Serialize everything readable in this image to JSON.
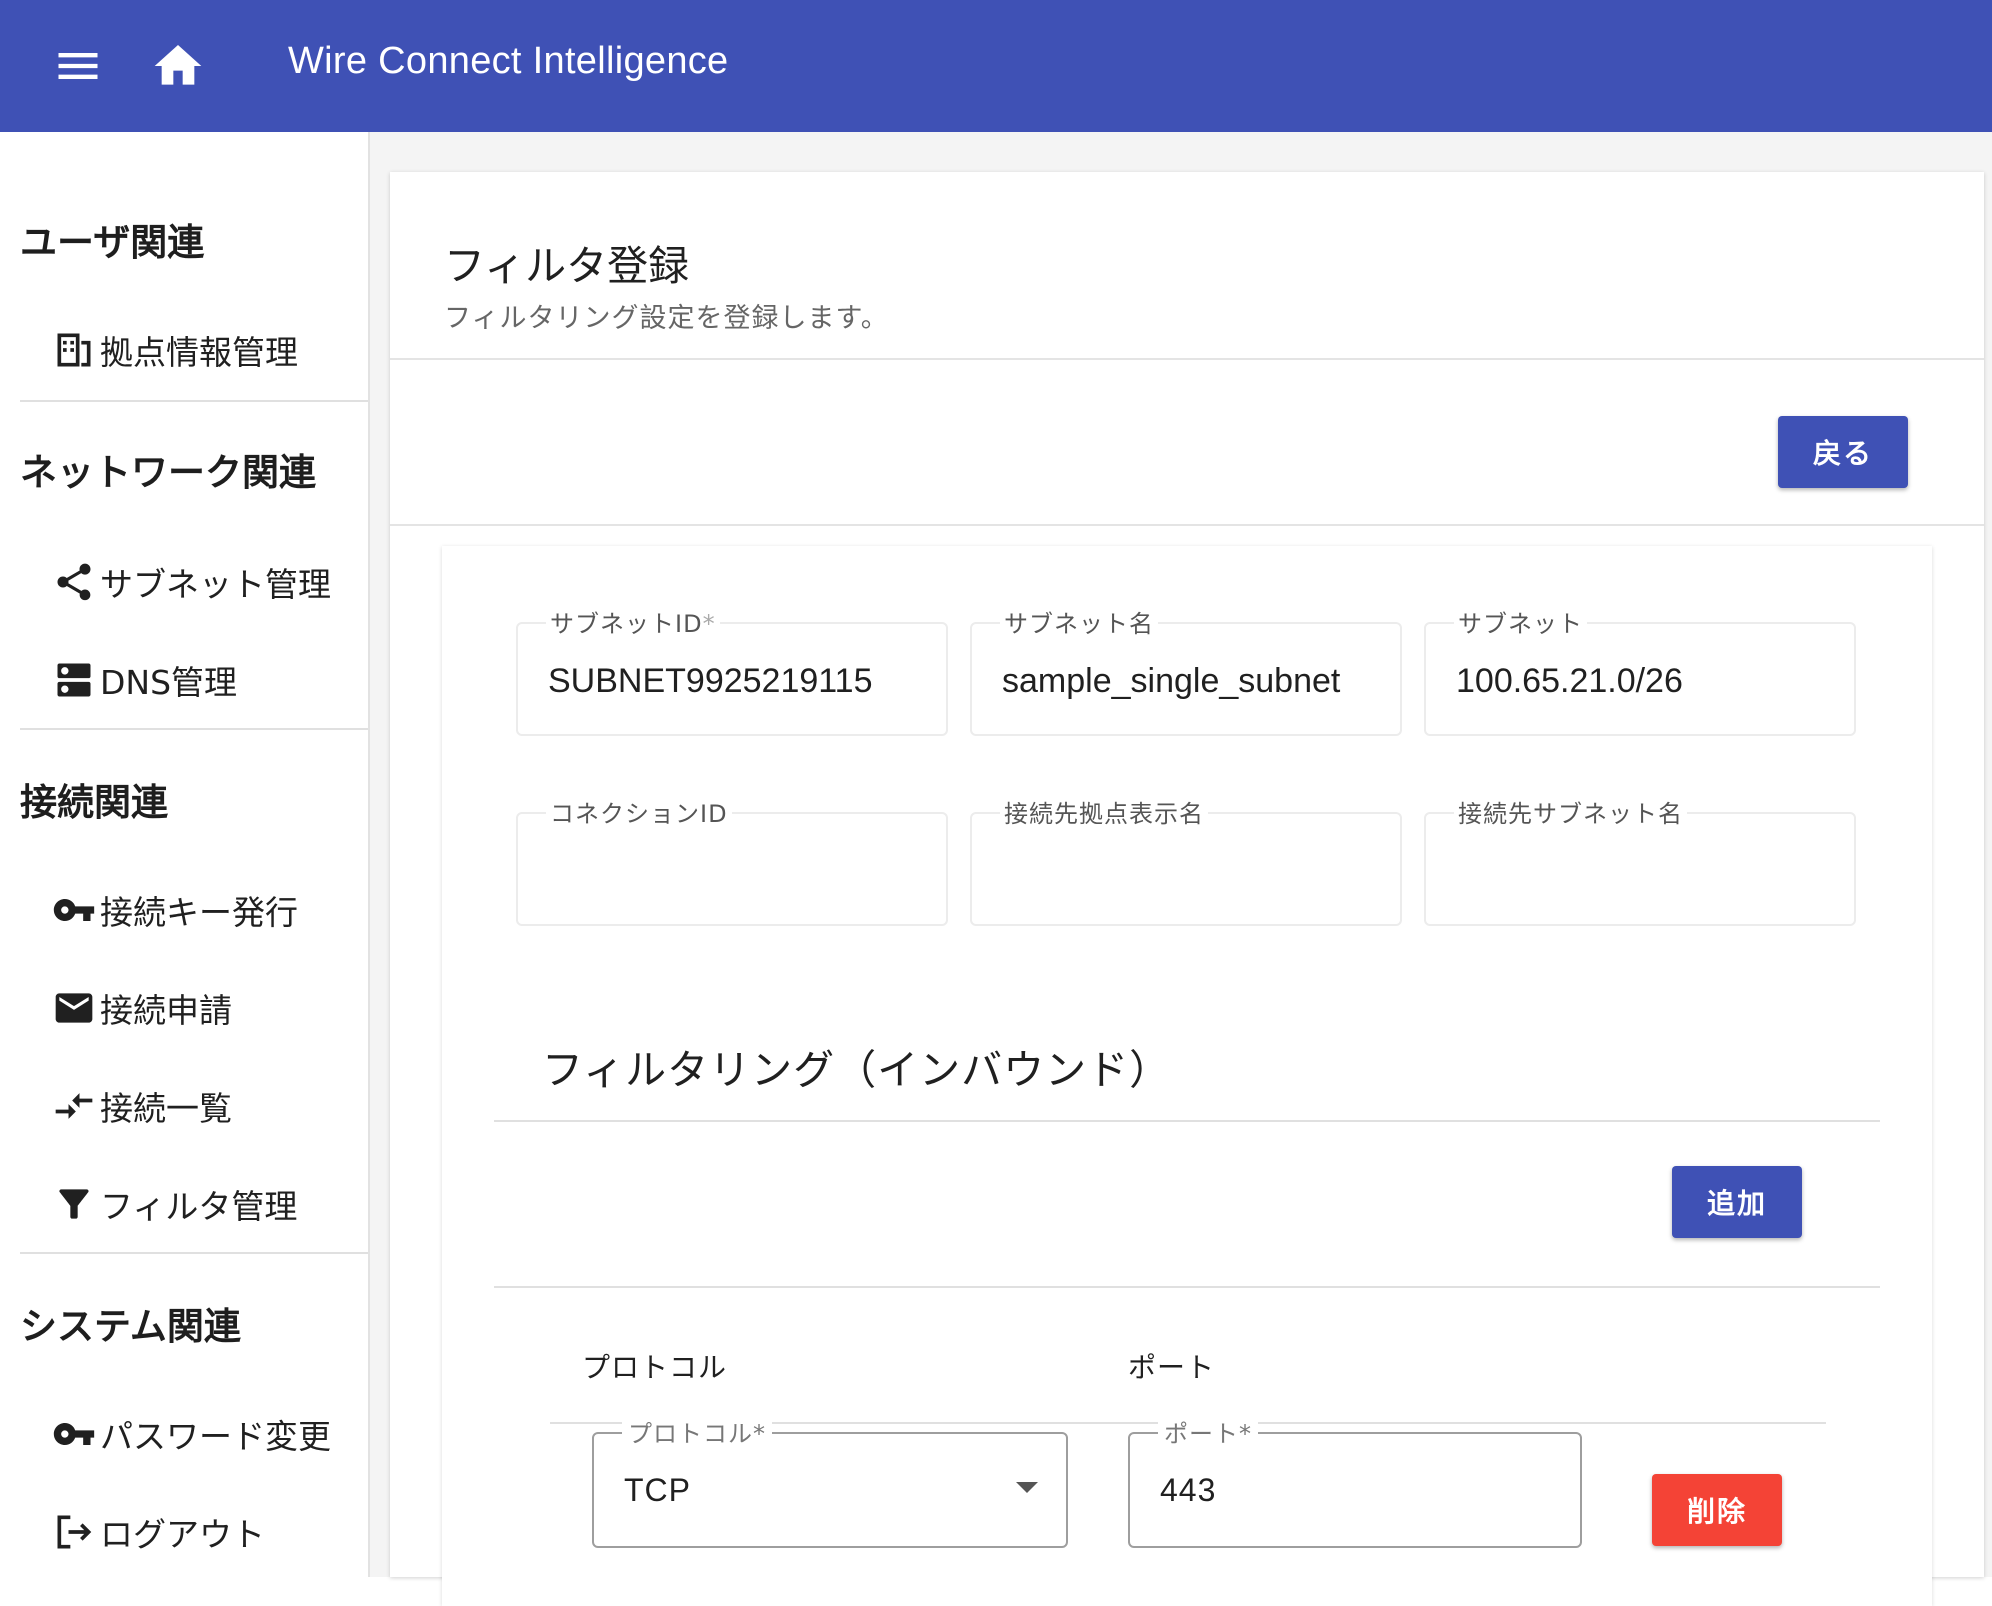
{
  "appbar": {
    "title": "Wire Connect Intelligence",
    "menu_icon": "menu-icon",
    "home_icon": "home-icon",
    "color": "#3f51b5"
  },
  "sidebar": {
    "sections": [
      {
        "title": "ユーザ関連",
        "items": [
          {
            "label": "拠点情報管理",
            "icon": "building-icon"
          }
        ]
      },
      {
        "title": "ネットワーク関連",
        "items": [
          {
            "label": "サブネット管理",
            "icon": "share-icon"
          },
          {
            "label": "DNS管理",
            "icon": "dns-icon"
          }
        ]
      },
      {
        "title": "接続関連",
        "items": [
          {
            "label": "接続キー発行",
            "icon": "key-icon"
          },
          {
            "label": "接続申請",
            "icon": "mail-icon"
          },
          {
            "label": "接続一覧",
            "icon": "compare-arrows-icon"
          },
          {
            "label": "フィルタ管理",
            "icon": "filter-icon"
          }
        ]
      },
      {
        "title": "システム関連",
        "items": [
          {
            "label": "パスワード変更",
            "icon": "key-icon"
          },
          {
            "label": "ログアウト",
            "icon": "logout-icon"
          }
        ]
      }
    ]
  },
  "page": {
    "title": "フィルタ登録",
    "subtitle": "フィルタリング設定を登録します。",
    "back_label": "戻る"
  },
  "form": {
    "subnet_id": {
      "label": "サブネットID",
      "required_mark": "*",
      "value": "SUBNET9925219115"
    },
    "subnet_name": {
      "label": "サブネット名",
      "value": "sample_single_subnet"
    },
    "subnet": {
      "label": "サブネット",
      "value": "100.65.21.0/26"
    },
    "connection_id": {
      "label": "コネクションID",
      "value": ""
    },
    "dest_site_name": {
      "label": "接続先拠点表示名",
      "value": ""
    },
    "dest_subnet_name": {
      "label": "接続先サブネット名",
      "value": ""
    }
  },
  "inbound": {
    "title": "フィルタリング（インバウンド）",
    "add_label": "追加",
    "columns": {
      "protocol": "プロトコル",
      "port": "ポート"
    },
    "rows": [
      {
        "protocol_label": "プロトコル*",
        "protocol": "TCP",
        "port_label": "ポート*",
        "port": "443",
        "delete_label": "削除"
      }
    ]
  },
  "colors": {
    "primary": "#3f51b5",
    "danger": "#f44336"
  }
}
